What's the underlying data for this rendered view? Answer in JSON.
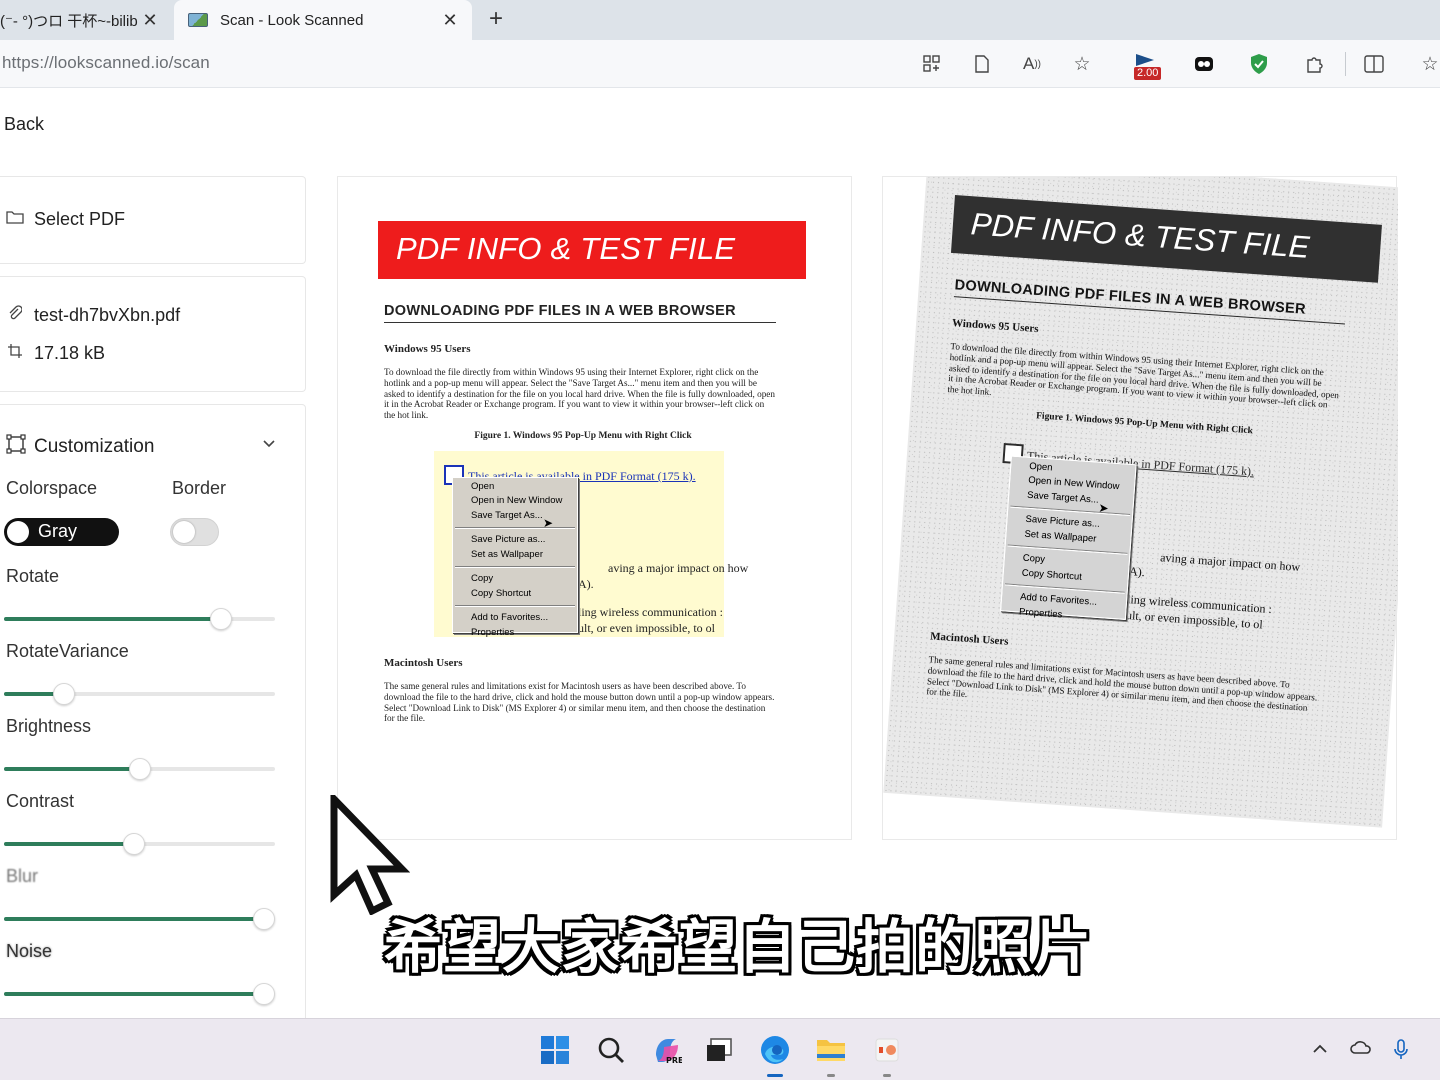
{
  "browser": {
    "tabs": [
      {
        "label": "(⁻- °)つロ 干杯~-bilib",
        "active": false
      },
      {
        "label": "Scan - Look Scanned",
        "active": true
      }
    ],
    "url_host": "https://lookscanned.io",
    "url_path": "/scan",
    "extension_badge": "2.00",
    "toolbar_icons": [
      "apps-icon",
      "reader-icon",
      "read-aloud-icon",
      "favorite-star-icon",
      "extension-flag-icon",
      "game-icon",
      "shield-icon",
      "puzzle-icon",
      "split-screen-icon",
      "favorites-icon"
    ]
  },
  "page": {
    "back_label": "Back",
    "select_pdf_label": "Select PDF",
    "file": {
      "name": "test-dh7bvXbn.pdf",
      "size": "17.18 kB"
    },
    "customization": {
      "title": "Customization",
      "colorspace_label": "Colorspace",
      "colorspace_value": "Gray",
      "border_label": "Border",
      "border_enabled": false,
      "sliders": [
        {
          "label": "Rotate",
          "value_fraction": 0.8
        },
        {
          "label": "RotateVariance",
          "value_fraction": 0.22
        },
        {
          "label": "Brightness",
          "value_fraction": 0.5
        },
        {
          "label": "Contrast",
          "value_fraction": 0.48
        },
        {
          "label": "Blur",
          "value_fraction": 0.96
        },
        {
          "label": "Noise",
          "value_fraction": 0.96
        }
      ]
    },
    "document": {
      "banner": "PDF INFO & TEST FILE",
      "heading": "DOWNLOADING PDF FILES IN A WEB BROWSER",
      "section1_title": "Windows 95 Users",
      "section1_text": "To download the file directly from within Windows 95 using their Internet Explorer, right click on the hotlink and a pop-up menu will appear. Select the \"Save Target As...\" menu item and then you will be asked to identify a destination for the file on you local hard drive. When the file is fully downloaded, open it in the Acrobat Reader or Exchange program. If you want to view it within your browser--left click on the hot link.",
      "figure_caption": "Figure 1. Windows 95 Pop-Up Menu with Right Click",
      "figure_link": "This article is available in PDF Format (175 k).",
      "figure_fragments": [
        "aving a major impact on how",
        "A).",
        "ling wireless communication :",
        "ult, or even impossible, to ol"
      ],
      "context_menu": [
        "Open",
        "Open in New Window",
        "Save Target As...",
        "Save Picture as...",
        "Set as Wallpaper",
        "Copy",
        "Copy Shortcut",
        "Add to Favorites...",
        "Properties"
      ],
      "section2_title": "Macintosh Users",
      "section2_text": "The same general rules and limitations exist for Macintosh users as have been described above. To download the file to the hard drive, click and hold the mouse button down until a pop-up window appears. Select \"Download Link to Disk\" (MS Explorer 4) or similar menu item, and then choose the destination for the file."
    }
  },
  "overlay": {
    "subtitle": "希望大家希望自己拍的照片"
  },
  "colors": {
    "accent_green": "#2e7d5b",
    "banner_red": "#ee1c1c",
    "toggle_on": "#111111"
  },
  "taskbar": {
    "icons": [
      "windows-start-icon",
      "search-icon",
      "copilot-icon",
      "task-view-icon",
      "edge-browser-icon",
      "file-explorer-icon",
      "powerpoint-icon"
    ],
    "tray_icons": [
      "chevron-up-icon",
      "onedrive-icon",
      "microphone-icon"
    ]
  }
}
